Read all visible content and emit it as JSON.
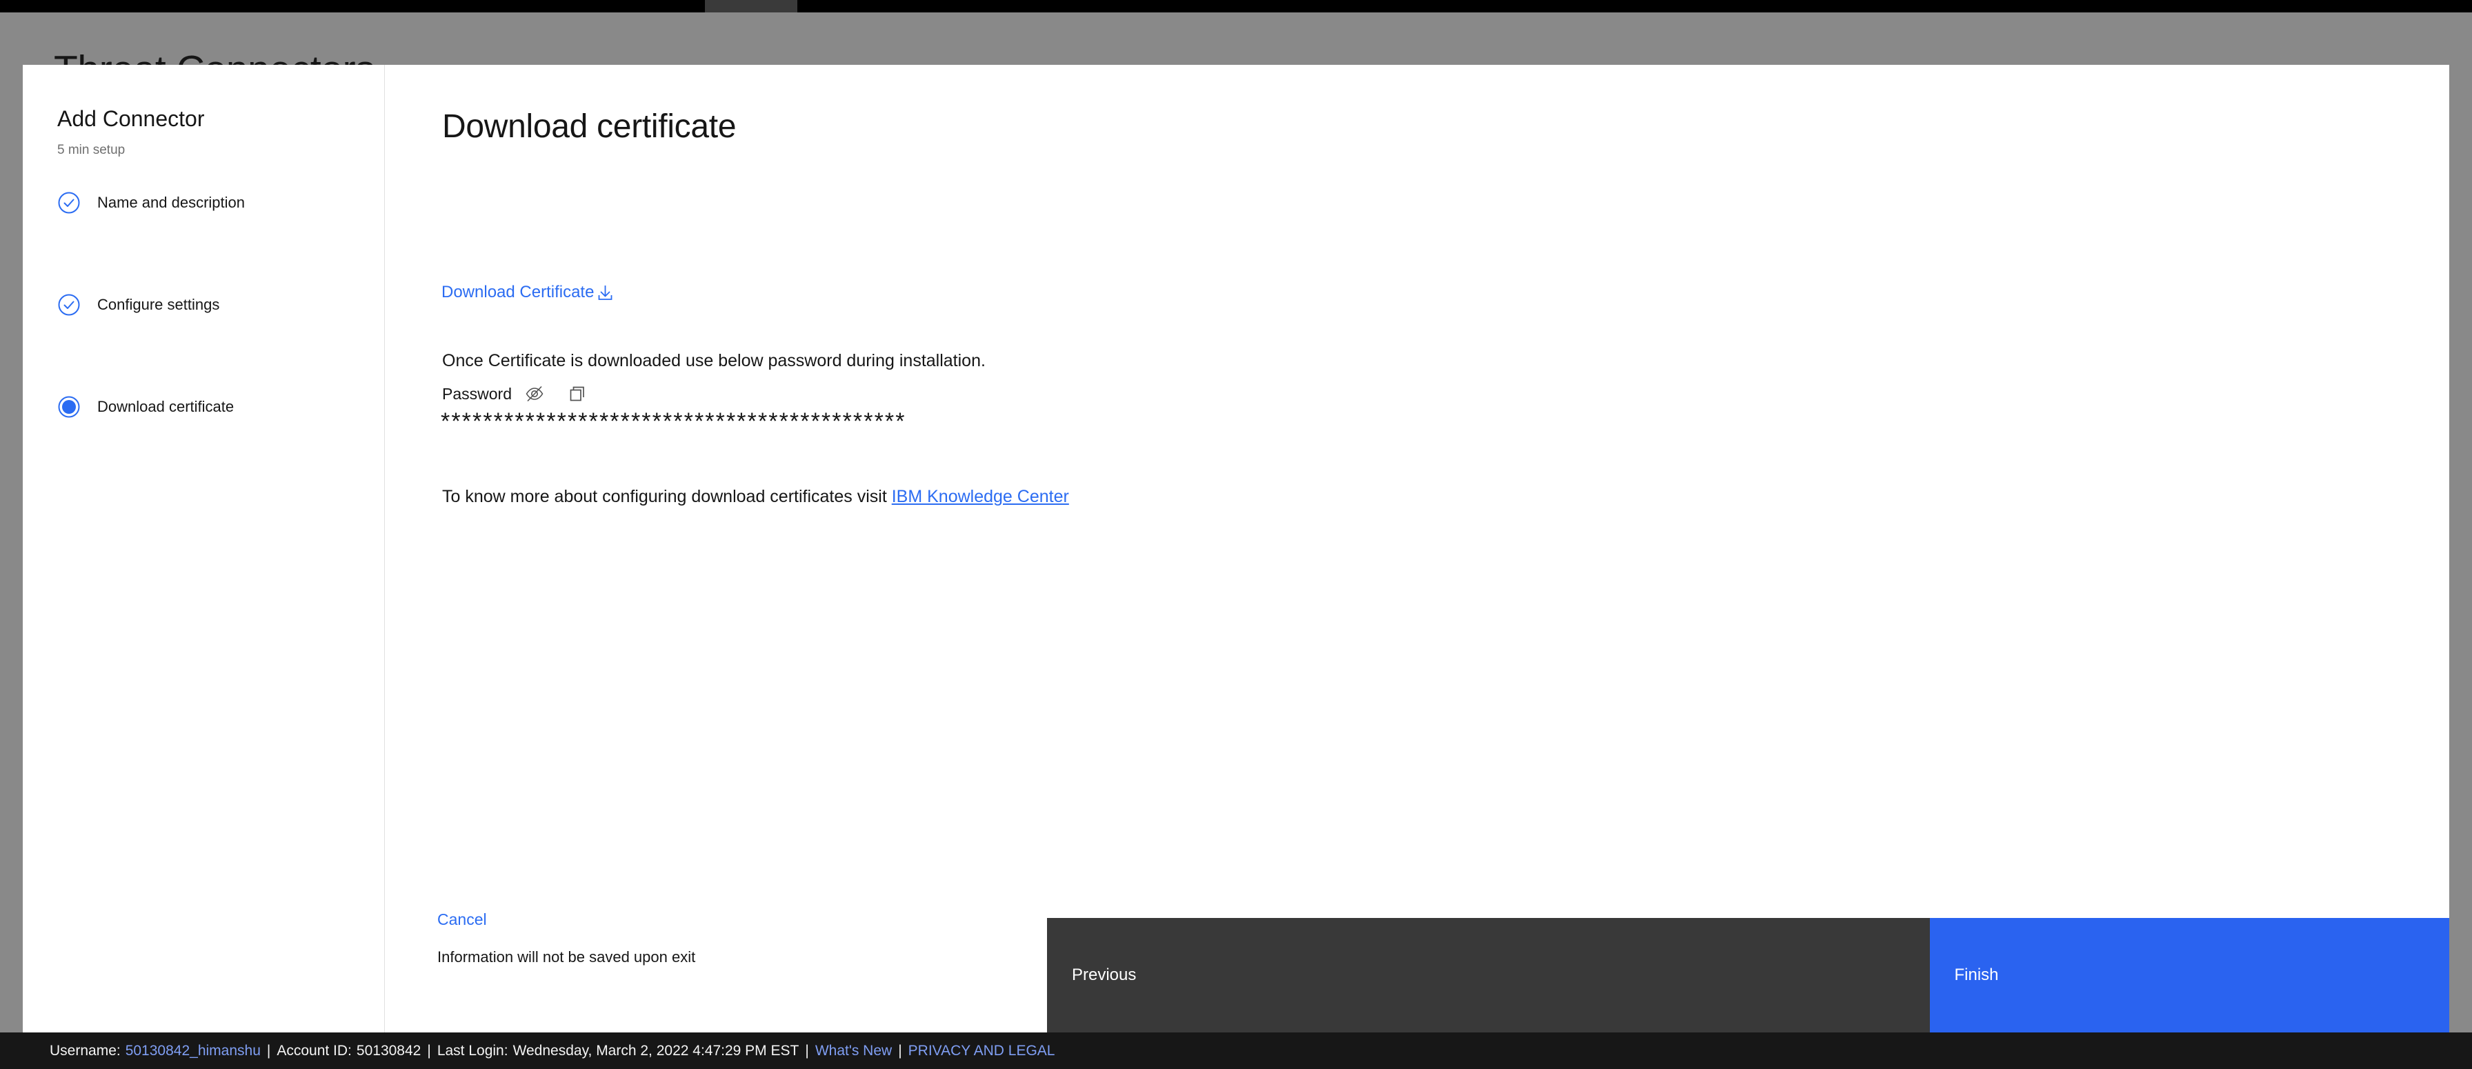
{
  "background_page": {
    "heading": "Threat Connectors"
  },
  "wizard": {
    "title": "Add Connector",
    "subtitle": "5 min setup",
    "steps": [
      {
        "label": "Name and description",
        "state": "complete",
        "icon": "check-circle-icon"
      },
      {
        "label": "Configure settings",
        "state": "complete",
        "icon": "check-circle-icon"
      },
      {
        "label": "Download certificate",
        "state": "current",
        "icon": "radio-filled-icon"
      }
    ]
  },
  "content": {
    "title": "Download certificate",
    "download_link": "Download Certificate",
    "download_icon": "download-icon",
    "instruction": "Once Certificate is downloaded use below password during installation.",
    "password_label": "Password",
    "hide_icon": "eye-slash-icon",
    "copy_icon": "copy-icon",
    "password_masked": "********************************************",
    "more_info_prefix": "To know more about configuring download certificates visit ",
    "more_info_link": "IBM Knowledge Center"
  },
  "footer": {
    "cancel_label": "Cancel",
    "exit_note": "Information will not be saved upon exit",
    "previous_label": "Previous",
    "finish_label": "Finish"
  },
  "status_bar": {
    "username_label": "Username:",
    "username_value": "50130842_himanshu",
    "account_label": "Account ID:",
    "account_value": "50130842",
    "last_login_label": "Last Login:",
    "last_login_value": "Wednesday, March 2, 2022 4:47:29 PM EST",
    "whats_new": "What's New",
    "privacy": "PRIVACY AND LEGAL",
    "separator": "|"
  },
  "colors": {
    "accent_blue": "#2b6cf2",
    "finish_blue": "#2a63f0",
    "previous_gray": "#393939",
    "status_bar_bg": "#171717",
    "overlay_gray": "#898989",
    "link_blue_status": "#7f9ef3"
  }
}
